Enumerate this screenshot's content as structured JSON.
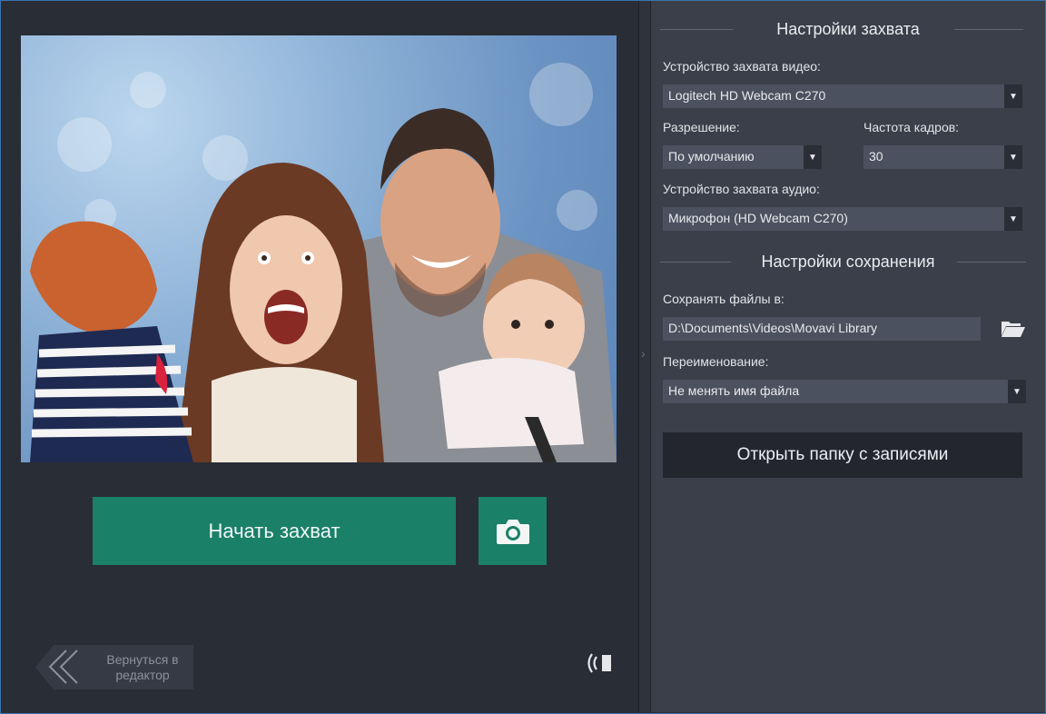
{
  "capture": {
    "start_label": "Начать захват",
    "back_label": "Вернуться в редактор"
  },
  "settings": {
    "capture_title": "Настройки захвата",
    "video_device_label": "Устройство захвата видео:",
    "video_device_value": "Logitech HD Webcam C270",
    "resolution_label": "Разрешение:",
    "resolution_value": "По умолчанию",
    "fps_label": "Частота кадров:",
    "fps_value": "30",
    "audio_device_label": "Устройство захвата аудио:",
    "audio_device_value": "Микрофон (HD Webcam C270)",
    "save_title": "Настройки сохранения",
    "save_to_label": "Сохранять файлы в:",
    "save_to_value": "D:\\Documents\\Videos\\Movavi Library",
    "rename_label": "Переименование:",
    "rename_value": "Не менять имя файла",
    "open_folder_label": "Открыть папку с записями"
  },
  "icons": {
    "snapshot": "camera-icon",
    "audio": "speaker-icon",
    "folder": "folder-icon",
    "back": "double-chevron-left-icon",
    "dropdown": "triangle-down-icon"
  },
  "colors": {
    "accent": "#1b8068",
    "window_border": "#3a74b0",
    "left_bg": "#292d36",
    "right_bg": "#3a3f4a"
  }
}
